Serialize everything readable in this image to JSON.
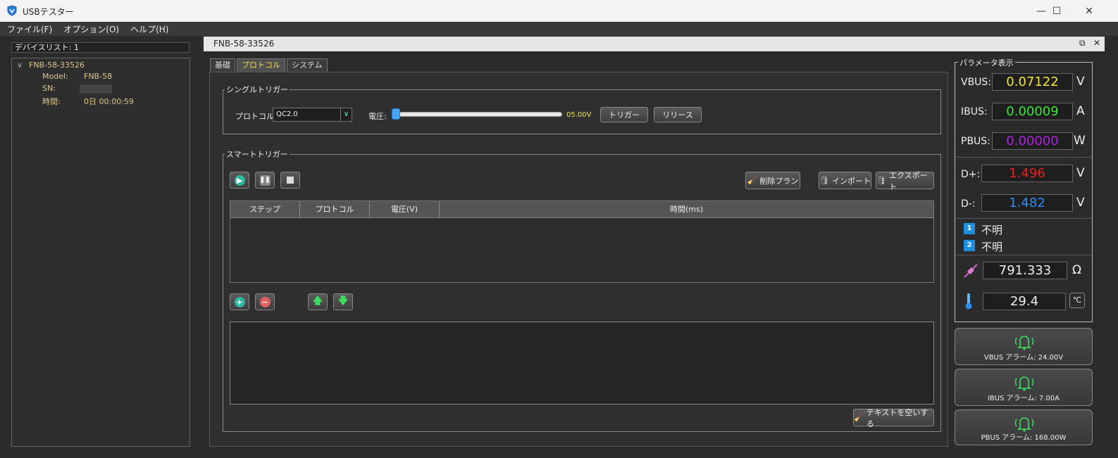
{
  "window": {
    "title": "USBテスター",
    "min": "—",
    "max": "☐",
    "close": "✕"
  },
  "menu": [
    "ファイル(F)",
    "オプション(O)",
    "ヘルプ(H)"
  ],
  "device_list": {
    "title": "デバイスリスト: 1",
    "device_name": "FNB-58-33526",
    "model_label": "Model:",
    "model_value": "FNB-58",
    "sn_label": "SN:",
    "time_label": "時間:",
    "time_value": "0日 00:00:59"
  },
  "doc": {
    "name": "FNB-58-33526"
  },
  "tabs": [
    "基礎",
    "プロトコル",
    "システム"
  ],
  "single_trigger": {
    "legend": "シングルトリガー",
    "protocol_label": "プロトコル:",
    "protocol_value": "QC2.0",
    "voltage_label": "電圧:",
    "voltage_value": "05.00V",
    "voltage_level": 0,
    "trigger_btn": "トリガー",
    "release_btn": "リリース"
  },
  "smart_trigger": {
    "legend": "スマートトリガー",
    "delete_plan": "削除プラン",
    "import": "インポート",
    "export": "エクスポート",
    "columns": [
      "ステップ",
      "プロトコル",
      "電圧(V)",
      "時間(ms)"
    ],
    "clear_text": "テキストを空いする"
  },
  "params": {
    "legend": "パラメータ表示",
    "vbus_label": "VBUS:",
    "vbus_value": "0.07122",
    "vbus_unit": "V",
    "ibus_label": "IBUS:",
    "ibus_value": "0.00009",
    "ibus_unit": "A",
    "pbus_label": "PBUS:",
    "pbus_value": "0.00000",
    "pbus_unit": "W",
    "dp_label": "D+:",
    "dp_value": "1.496",
    "dp_unit": "V",
    "dm_label": "D-:",
    "dm_value": "1.482",
    "dm_unit": "V",
    "port1_num": "1",
    "port1_status": "不明",
    "port2_num": "2",
    "port2_status": "不明",
    "resistance_value": "791.333",
    "resistance_unit": "Ω",
    "temp_value": "29.4",
    "temp_unit": "℃",
    "colors": {
      "vbus": "#f2e63a",
      "ibus": "#39e639",
      "pbus": "#b020e0",
      "dp": "#e8201e",
      "dm": "#2e8ef0"
    }
  },
  "alarms": [
    {
      "label": "VBUS アラーム: 24.00V"
    },
    {
      "label": "IBUS アラーム: 7.00A"
    },
    {
      "label": "PBUS アラーム: 168.00W"
    }
  ]
}
